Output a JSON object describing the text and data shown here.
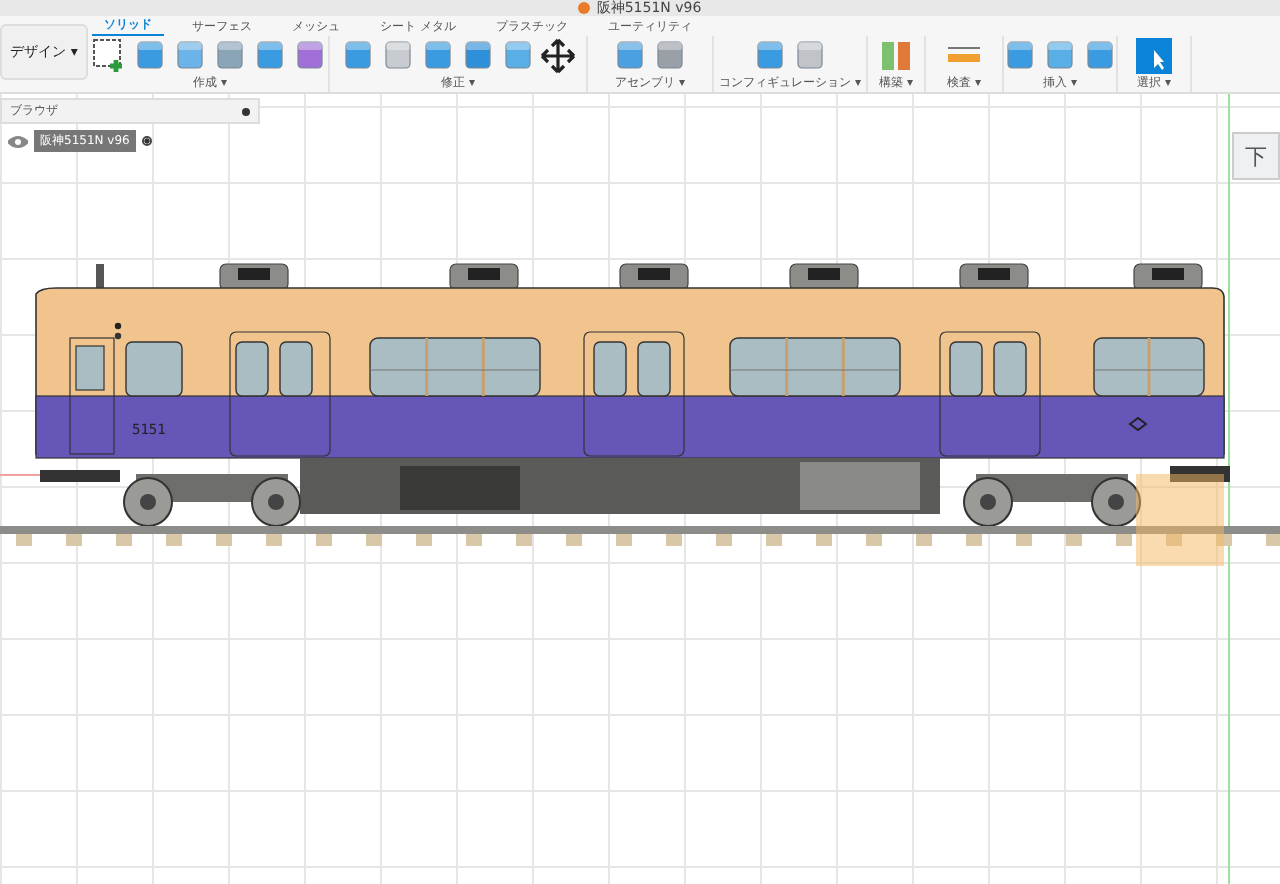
{
  "window": {
    "title": "阪神5151N v96"
  },
  "workspace": {
    "label": "デザイン ▾"
  },
  "tabs": [
    {
      "label": "ソリッド",
      "selected": true
    },
    {
      "label": "サーフェス",
      "selected": false
    },
    {
      "label": "メッシュ",
      "selected": false
    },
    {
      "label": "シート メタル",
      "selected": false
    },
    {
      "label": "プラスチック",
      "selected": false
    },
    {
      "label": "ユーティリティ",
      "selected": false
    }
  ],
  "tool_groups": [
    {
      "label": "作成 ▾"
    },
    {
      "label": "修正 ▾"
    },
    {
      "label": "アセンブリ ▾"
    },
    {
      "label": "コンフィギュレーション ▾"
    },
    {
      "label": "構築 ▾"
    },
    {
      "label": "検査 ▾"
    },
    {
      "label": "挿入 ▾"
    },
    {
      "label": "選択 ▾"
    }
  ],
  "browser": {
    "title": "ブラウザ",
    "items": [
      {
        "label": "阪神5151N v96",
        "visible": true,
        "active": true
      }
    ]
  },
  "view_cube": {
    "face": "下"
  },
  "model": {
    "car_number": "5151"
  }
}
